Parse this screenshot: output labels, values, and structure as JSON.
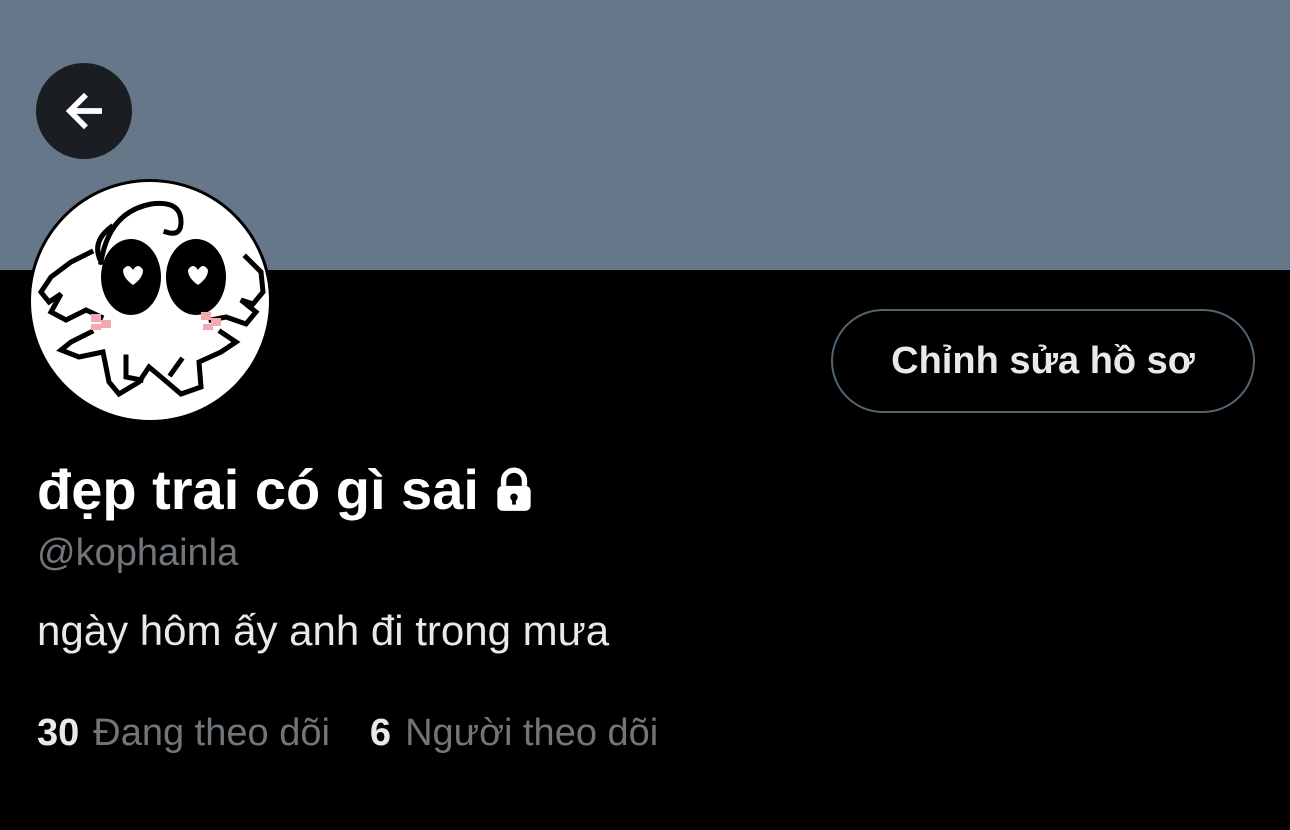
{
  "profile": {
    "display_name": "đẹp trai có gì sai",
    "handle": "@kophainla",
    "bio": "ngày hôm ấy anh đi trong mưa",
    "edit_button_label": "Chỉnh sửa hồ sơ",
    "protected_icon": "lock-icon"
  },
  "stats": {
    "following_count": "30",
    "following_label": "Đang theo dõi",
    "followers_count": "6",
    "followers_label": "Người theo dõi"
  },
  "nav": {
    "back_icon": "arrow-left-icon"
  },
  "colors": {
    "banner": "#66778a",
    "background": "#000000",
    "secondary_text": "#71767b",
    "primary_text": "#e7e9ea"
  }
}
